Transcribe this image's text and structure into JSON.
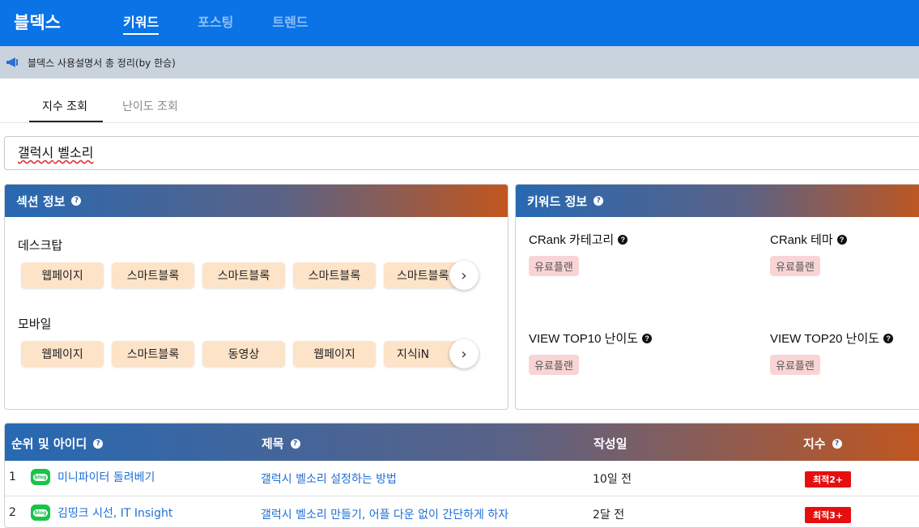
{
  "header": {
    "brand": "블덱스",
    "nav": [
      "키워드",
      "포스팅",
      "트렌드"
    ]
  },
  "notice": {
    "text": "블덱스 사용설명서 총 정리(by 한승)"
  },
  "subtabs": [
    "지수 조회",
    "난이도 조회"
  ],
  "search": {
    "value_main": "갤럭시",
    "value_rest": " 벨소리"
  },
  "section_info": {
    "title": "섹션 정보",
    "desktop": {
      "label": "데스크탑",
      "chips": [
        "웹페이지",
        "스마트블록",
        "스마트블록",
        "스마트블록",
        "스마트블록"
      ]
    },
    "mobile": {
      "label": "모바일",
      "chips": [
        "웹페이지",
        "스마트블록",
        "동영상",
        "웹페이지",
        "지식iN"
      ]
    },
    "next_glyph": "›"
  },
  "keyword_info": {
    "title": "키워드 정보",
    "items": [
      {
        "title": "CRank 카테고리",
        "badge": "유료플랜"
      },
      {
        "title": "CRank 테마",
        "badge": "유료플랜"
      },
      {
        "title": "VIEW TOP10 난이도",
        "badge": "유료플랜"
      },
      {
        "title": "VIEW TOP20 난이도",
        "badge": "유료플랜"
      }
    ]
  },
  "results": {
    "headers": [
      "순위 및 아이디",
      "제목",
      "작성일",
      "지수"
    ],
    "rows": [
      {
        "rank": "1",
        "blog": "미니파이터 돌려베기",
        "title": "갤럭시 벨소리 설정하는 방법",
        "date": "10일 전",
        "index": "최적2+"
      },
      {
        "rank": "2",
        "blog": "김띵크 시선, IT Insight",
        "title": "갤럭시 벨소리 만들기, 어플 다운 없이 간단하게 하자",
        "date": "2달 전",
        "index": "최적3+"
      }
    ],
    "blog_icon_text": "blog",
    "badge_color": "#e60f0f"
  },
  "colors": {
    "topbar": "#0a73e6",
    "notice_bg": "#c9d3de",
    "chip_bg": "#fde3c8",
    "link": "#1f6fd6"
  }
}
